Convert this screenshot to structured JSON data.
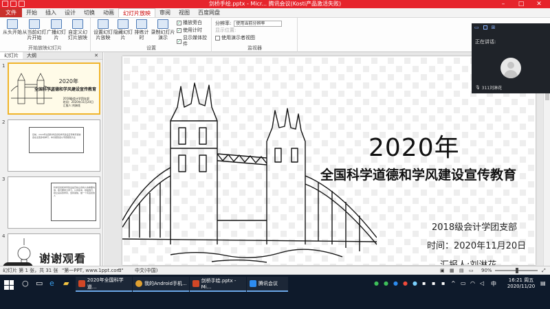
{
  "titlebar": {
    "title": "剑桥手绘.pptx - Micr... 腾讯会议(Kosti产品激活失败)",
    "minimize": "–",
    "maximize": "□",
    "close": "✕"
  },
  "tabs": [
    "文件",
    "开始",
    "插入",
    "设计",
    "切换",
    "动画",
    "幻灯片放映",
    "审阅",
    "视图",
    "百度网盘"
  ],
  "ribbon": {
    "btn_from_start": "从头开始",
    "btn_from_current": "从当前幻灯片开始",
    "btn_broadcast": "广播幻灯片",
    "btn_custom": "自定义幻灯片放映",
    "group_start_show": "开始放映幻灯片",
    "btn_setup": "设置幻灯片放映",
    "btn_hide": "隐藏幻灯片",
    "btn_rehearse": "排练计时",
    "btn_record": "录制幻灯片演示",
    "chk_narration": "播放旁白",
    "chk_timings": "使用计时",
    "chk_media": "显示媒体控件",
    "group_setup": "设置",
    "resolution_label": "分辨率:",
    "resolution_value": "使用当前分辨率",
    "show_on_label": "显示位置:",
    "presenter_view": "使用演示者视图",
    "group_monitor": "监视器"
  },
  "thumbpane": {
    "tab_slides": "幻灯片",
    "tab_outline": "大纲",
    "close": "✕",
    "slide1": {
      "num": "1",
      "year": "2020年",
      "title": "全国科学道德和学风建设宣传教育",
      "org": "2018级会计学团支部",
      "date": "时间：2020年11月20日",
      "reporter": "汇报人:刘淋花"
    },
    "slide2": {
      "num": "2",
      "text": "目前，2020年全国科学道德和学风建设宣传教育报告会在全国多地举行，本次报告会以专题报告为主"
    },
    "slide3": {
      "num": "3",
      "text": "科学道德和学风建设是高校立德树人的重要内容，我们要努力学习，认真思考，积极践行，树立良好的学风，坚持诚信，做一个有道德的人"
    },
    "slide4": {
      "num": "4",
      "text": "谢谢观看"
    }
  },
  "slide": {
    "year": "2020年",
    "title": "全国科学道德和学风建设宣传教育",
    "org": "2018级会计学团支部",
    "date": "时间：2020年11月20日",
    "reporter": "汇报人:刘淋花"
  },
  "meeting": {
    "speaking_label": "正在讲话:",
    "participant": "311刘淋花"
  },
  "statusbar": {
    "slide_info": "幻灯片 第 1 张，共 31 张",
    "theme": "\"第一PPT, www.1ppt.com\"",
    "language": "中文(中国)",
    "zoom": "90%"
  },
  "taskbar": {
    "tasks": [
      "2020年全国科学道...",
      "我的Android手机...",
      "剑桥手绘.pptx - Mi...",
      "腾讯会议"
    ],
    "ime": "中",
    "time": "16:21 周五",
    "date": "2020/11/20"
  },
  "colors": {
    "titlebar": "#e6242c",
    "file_tab": "#c9302c",
    "active_tab_text": "#cc0000",
    "selected_thumb_border": "#f0b429",
    "taskbar": "#0e1a2b"
  }
}
